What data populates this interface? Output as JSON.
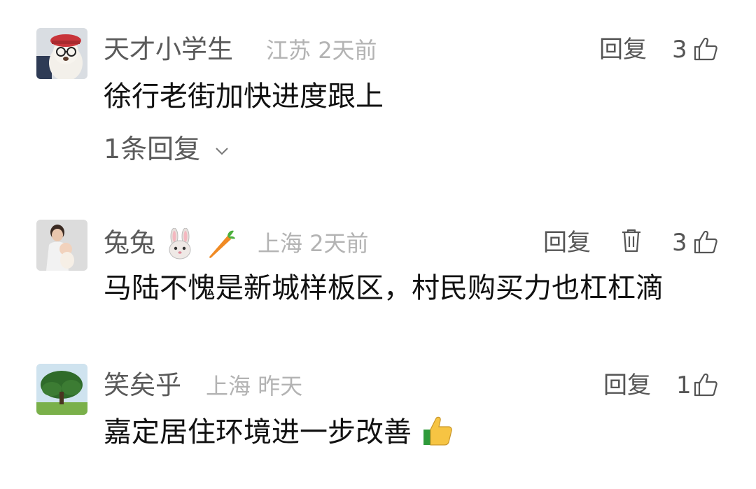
{
  "comments": [
    {
      "username": "天才小学生",
      "location": "江苏",
      "time": "2天前",
      "text": "徐行老街加快进度跟上",
      "reply_label": "回复",
      "likes": "3",
      "replies_toggle": "1条回复"
    },
    {
      "username": "兔兔",
      "username_emojis": [
        "rabbit-face-emoji",
        "carrot-emoji"
      ],
      "location": "上海",
      "time": "2天前",
      "text": "马陆不愧是新城样板区，村民购买力也杠杠滴",
      "reply_label": "回复",
      "likes": "3"
    },
    {
      "username": "笑矣乎",
      "location": "上海",
      "time": "昨天",
      "text": "嘉定居住环境进一步改善",
      "text_emoji": "thumbs-up-emoji",
      "reply_label": "回复",
      "likes": "1"
    }
  ]
}
